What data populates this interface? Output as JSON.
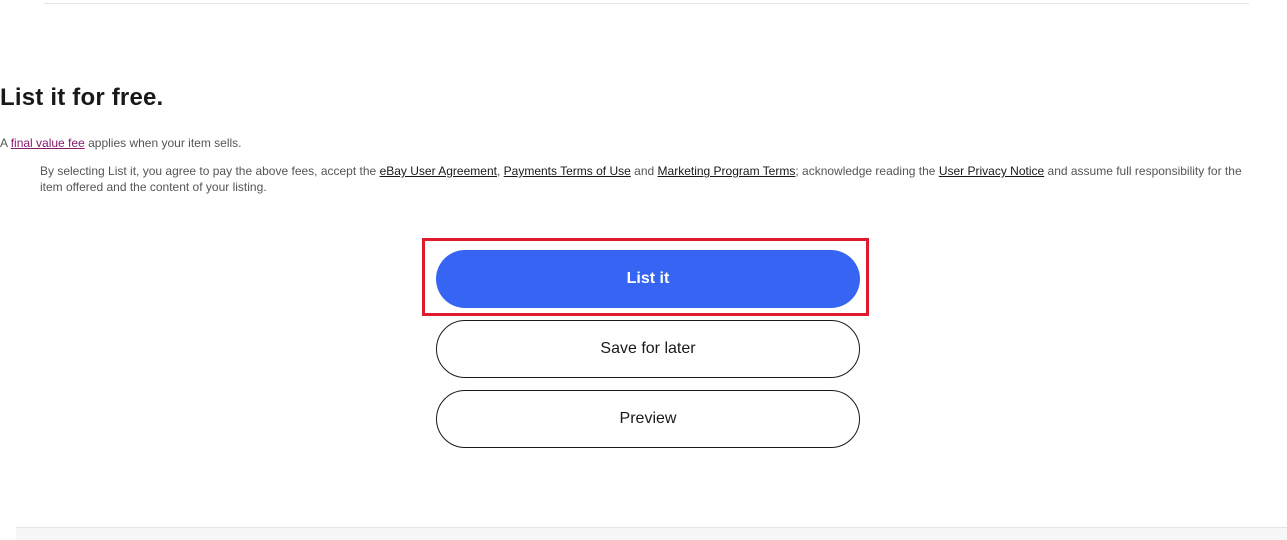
{
  "header": {
    "title": "List it for free."
  },
  "fee_note": {
    "prefix": "A",
    "link": "final value fee",
    "suffix": "applies when your item sells."
  },
  "legal": {
    "part1": "By selecting List it, you agree to pay the above fees, accept the",
    "link_user_agreement": "eBay User Agreement",
    "sep1": ",",
    "link_payments_terms": "Payments Terms of Use",
    "part2": "and",
    "link_marketing_terms": "Marketing Program Terms",
    "part3": "; acknowledge reading the",
    "link_privacy": "User Privacy Notice",
    "part4": "and assume full responsibility for the item offered and the content of your listing."
  },
  "actions": {
    "list_it_label": "List it",
    "save_for_later_label": "Save for later",
    "preview_label": "Preview"
  },
  "colors": {
    "primary": "#3665f3",
    "highlight": "#e0192f",
    "fee_link": "#8a1a6c"
  }
}
